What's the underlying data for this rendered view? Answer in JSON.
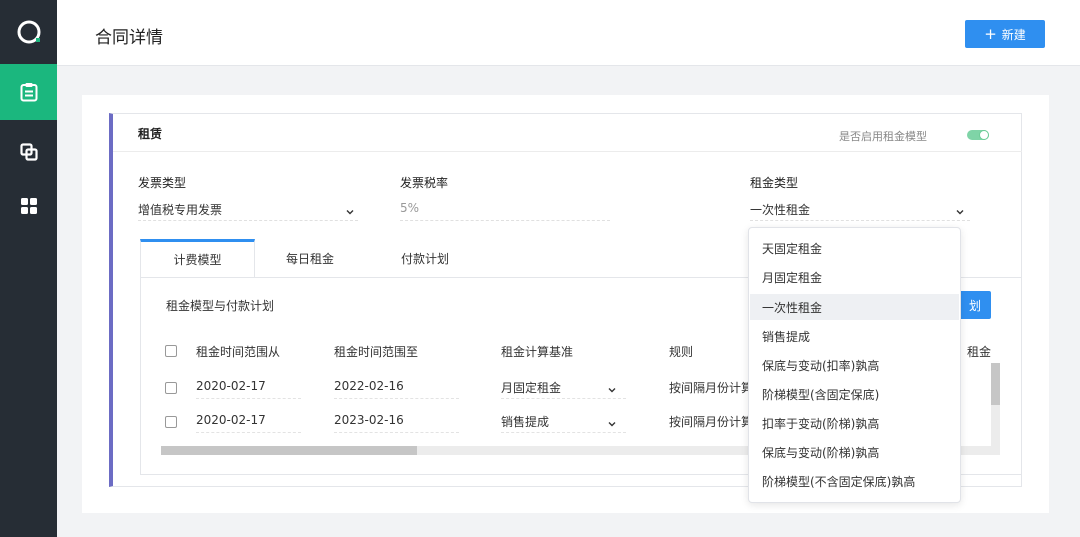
{
  "header": {
    "title": "合同详情",
    "new_button": "新建",
    "new_button_icon": "plus-icon"
  },
  "sidebar": {
    "items": [
      {
        "icon": "logo-ring-icon"
      },
      {
        "icon": "clipboard-icon",
        "active": true
      },
      {
        "icon": "copy-icon"
      },
      {
        "icon": "grid-icon"
      }
    ],
    "active_color": "#1bb77e"
  },
  "section": {
    "title": "租赁",
    "toggle_label": "是否启用租金模型",
    "toggle_on": true,
    "accent_color": "#6c6cc4",
    "fields": {
      "invoice_type": {
        "label": "发票类型",
        "value": "增值税专用发票"
      },
      "tax_rate": {
        "label": "发票税率",
        "placeholder": "5%"
      },
      "rent_type": {
        "label": "租金类型",
        "value": "一次性租金"
      }
    }
  },
  "tabs": [
    {
      "label": "计费模型",
      "active": true
    },
    {
      "label": "每日租金",
      "active": false
    },
    {
      "label": "付款计划",
      "active": false
    }
  ],
  "panel": {
    "title": "租金模型与付款计划",
    "plan_button": "划"
  },
  "table": {
    "headers": [
      "租金时间范围从",
      "租金时间范围至",
      "租金计算基准",
      "规则",
      "租金"
    ],
    "rows": [
      {
        "from": "2020-02-17",
        "to": "2022-02-16",
        "basis": "月固定租金",
        "rule": "按间隔月份计算"
      },
      {
        "from": "2020-02-17",
        "to": "2023-02-16",
        "basis": "销售提成",
        "rule": "按间隔月份计算"
      }
    ]
  },
  "dropdown": {
    "options": [
      "天固定租金",
      "月固定租金",
      "一次性租金",
      "销售提成",
      "保底与变动(扣率)孰高",
      "阶梯模型(含固定保底)",
      "扣率于变动(阶梯)孰高",
      "保底与变动(阶梯)孰高",
      "阶梯模型(不含固定保底)孰高"
    ],
    "selected": "一次性租金"
  },
  "colors": {
    "primary": "#2f8ff0",
    "sidebar_bg": "#262d35"
  }
}
